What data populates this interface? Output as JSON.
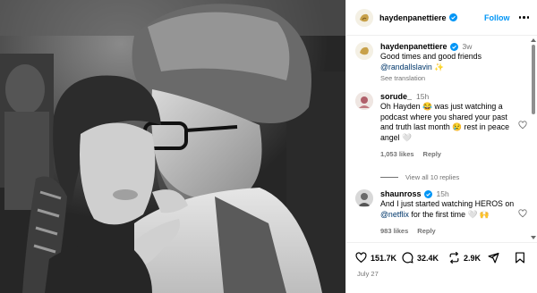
{
  "header": {
    "username": "haydenpanettiere",
    "follow_label": "Follow"
  },
  "caption": {
    "username": "haydenpanettiere",
    "time": "3w",
    "text": "Good times and good friends",
    "mention": "@randallslavin",
    "emoji": "✨",
    "see_translation": "See translation"
  },
  "comments": [
    {
      "username": "sorude_",
      "time": "15h",
      "text_before": "Oh Hayden",
      "emoji1": "😂",
      "text_middle": "was just watching a podcast where you shared your past and truth last month",
      "emoji2": "😢",
      "text_after": "rest in peace angel",
      "emoji3": "🤍",
      "likes": "1,053 likes",
      "reply_label": "Reply"
    },
    {
      "username": "shaunross",
      "time": "15h",
      "text_before": "And I just started watching HEROS on",
      "mention": "@netflix",
      "text_after": "for the first time",
      "emoji1": "🤍",
      "emoji2": "🙌",
      "likes": "983 likes",
      "reply_label": "Reply"
    }
  ],
  "view_all": "View all 10 replies",
  "actions": {
    "likes": "151.7K",
    "comments": "32.4K",
    "shares": "2.9K"
  },
  "date": "July 27",
  "colors": {
    "link": "#0095f6",
    "mention": "#00376b",
    "muted": "#737373",
    "verified": "#0095f6"
  }
}
